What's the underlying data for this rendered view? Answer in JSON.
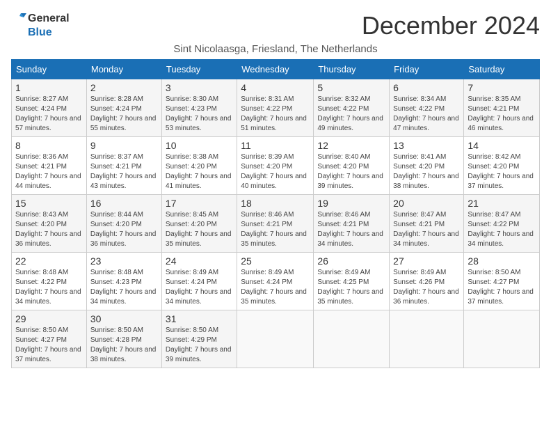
{
  "logo": {
    "line1": "General",
    "line2": "Blue"
  },
  "title": "December 2024",
  "subtitle": "Sint Nicolaasga, Friesland, The Netherlands",
  "days_of_week": [
    "Sunday",
    "Monday",
    "Tuesday",
    "Wednesday",
    "Thursday",
    "Friday",
    "Saturday"
  ],
  "weeks": [
    [
      {
        "day": 1,
        "sunrise": "8:27 AM",
        "sunset": "4:24 PM",
        "daylight": "7 hours and 57 minutes."
      },
      {
        "day": 2,
        "sunrise": "8:28 AM",
        "sunset": "4:24 PM",
        "daylight": "7 hours and 55 minutes."
      },
      {
        "day": 3,
        "sunrise": "8:30 AM",
        "sunset": "4:23 PM",
        "daylight": "7 hours and 53 minutes."
      },
      {
        "day": 4,
        "sunrise": "8:31 AM",
        "sunset": "4:22 PM",
        "daylight": "7 hours and 51 minutes."
      },
      {
        "day": 5,
        "sunrise": "8:32 AM",
        "sunset": "4:22 PM",
        "daylight": "7 hours and 49 minutes."
      },
      {
        "day": 6,
        "sunrise": "8:34 AM",
        "sunset": "4:22 PM",
        "daylight": "7 hours and 47 minutes."
      },
      {
        "day": 7,
        "sunrise": "8:35 AM",
        "sunset": "4:21 PM",
        "daylight": "7 hours and 46 minutes."
      }
    ],
    [
      {
        "day": 8,
        "sunrise": "8:36 AM",
        "sunset": "4:21 PM",
        "daylight": "7 hours and 44 minutes."
      },
      {
        "day": 9,
        "sunrise": "8:37 AM",
        "sunset": "4:21 PM",
        "daylight": "7 hours and 43 minutes."
      },
      {
        "day": 10,
        "sunrise": "8:38 AM",
        "sunset": "4:20 PM",
        "daylight": "7 hours and 41 minutes."
      },
      {
        "day": 11,
        "sunrise": "8:39 AM",
        "sunset": "4:20 PM",
        "daylight": "7 hours and 40 minutes."
      },
      {
        "day": 12,
        "sunrise": "8:40 AM",
        "sunset": "4:20 PM",
        "daylight": "7 hours and 39 minutes."
      },
      {
        "day": 13,
        "sunrise": "8:41 AM",
        "sunset": "4:20 PM",
        "daylight": "7 hours and 38 minutes."
      },
      {
        "day": 14,
        "sunrise": "8:42 AM",
        "sunset": "4:20 PM",
        "daylight": "7 hours and 37 minutes."
      }
    ],
    [
      {
        "day": 15,
        "sunrise": "8:43 AM",
        "sunset": "4:20 PM",
        "daylight": "7 hours and 36 minutes."
      },
      {
        "day": 16,
        "sunrise": "8:44 AM",
        "sunset": "4:20 PM",
        "daylight": "7 hours and 36 minutes."
      },
      {
        "day": 17,
        "sunrise": "8:45 AM",
        "sunset": "4:20 PM",
        "daylight": "7 hours and 35 minutes."
      },
      {
        "day": 18,
        "sunrise": "8:46 AM",
        "sunset": "4:21 PM",
        "daylight": "7 hours and 35 minutes."
      },
      {
        "day": 19,
        "sunrise": "8:46 AM",
        "sunset": "4:21 PM",
        "daylight": "7 hours and 34 minutes."
      },
      {
        "day": 20,
        "sunrise": "8:47 AM",
        "sunset": "4:21 PM",
        "daylight": "7 hours and 34 minutes."
      },
      {
        "day": 21,
        "sunrise": "8:47 AM",
        "sunset": "4:22 PM",
        "daylight": "7 hours and 34 minutes."
      }
    ],
    [
      {
        "day": 22,
        "sunrise": "8:48 AM",
        "sunset": "4:22 PM",
        "daylight": "7 hours and 34 minutes."
      },
      {
        "day": 23,
        "sunrise": "8:48 AM",
        "sunset": "4:23 PM",
        "daylight": "7 hours and 34 minutes."
      },
      {
        "day": 24,
        "sunrise": "8:49 AM",
        "sunset": "4:24 PM",
        "daylight": "7 hours and 34 minutes."
      },
      {
        "day": 25,
        "sunrise": "8:49 AM",
        "sunset": "4:24 PM",
        "daylight": "7 hours and 35 minutes."
      },
      {
        "day": 26,
        "sunrise": "8:49 AM",
        "sunset": "4:25 PM",
        "daylight": "7 hours and 35 minutes."
      },
      {
        "day": 27,
        "sunrise": "8:49 AM",
        "sunset": "4:26 PM",
        "daylight": "7 hours and 36 minutes."
      },
      {
        "day": 28,
        "sunrise": "8:50 AM",
        "sunset": "4:27 PM",
        "daylight": "7 hours and 37 minutes."
      }
    ],
    [
      {
        "day": 29,
        "sunrise": "8:50 AM",
        "sunset": "4:27 PM",
        "daylight": "7 hours and 37 minutes."
      },
      {
        "day": 30,
        "sunrise": "8:50 AM",
        "sunset": "4:28 PM",
        "daylight": "7 hours and 38 minutes."
      },
      {
        "day": 31,
        "sunrise": "8:50 AM",
        "sunset": "4:29 PM",
        "daylight": "7 hours and 39 minutes."
      },
      null,
      null,
      null,
      null
    ]
  ]
}
